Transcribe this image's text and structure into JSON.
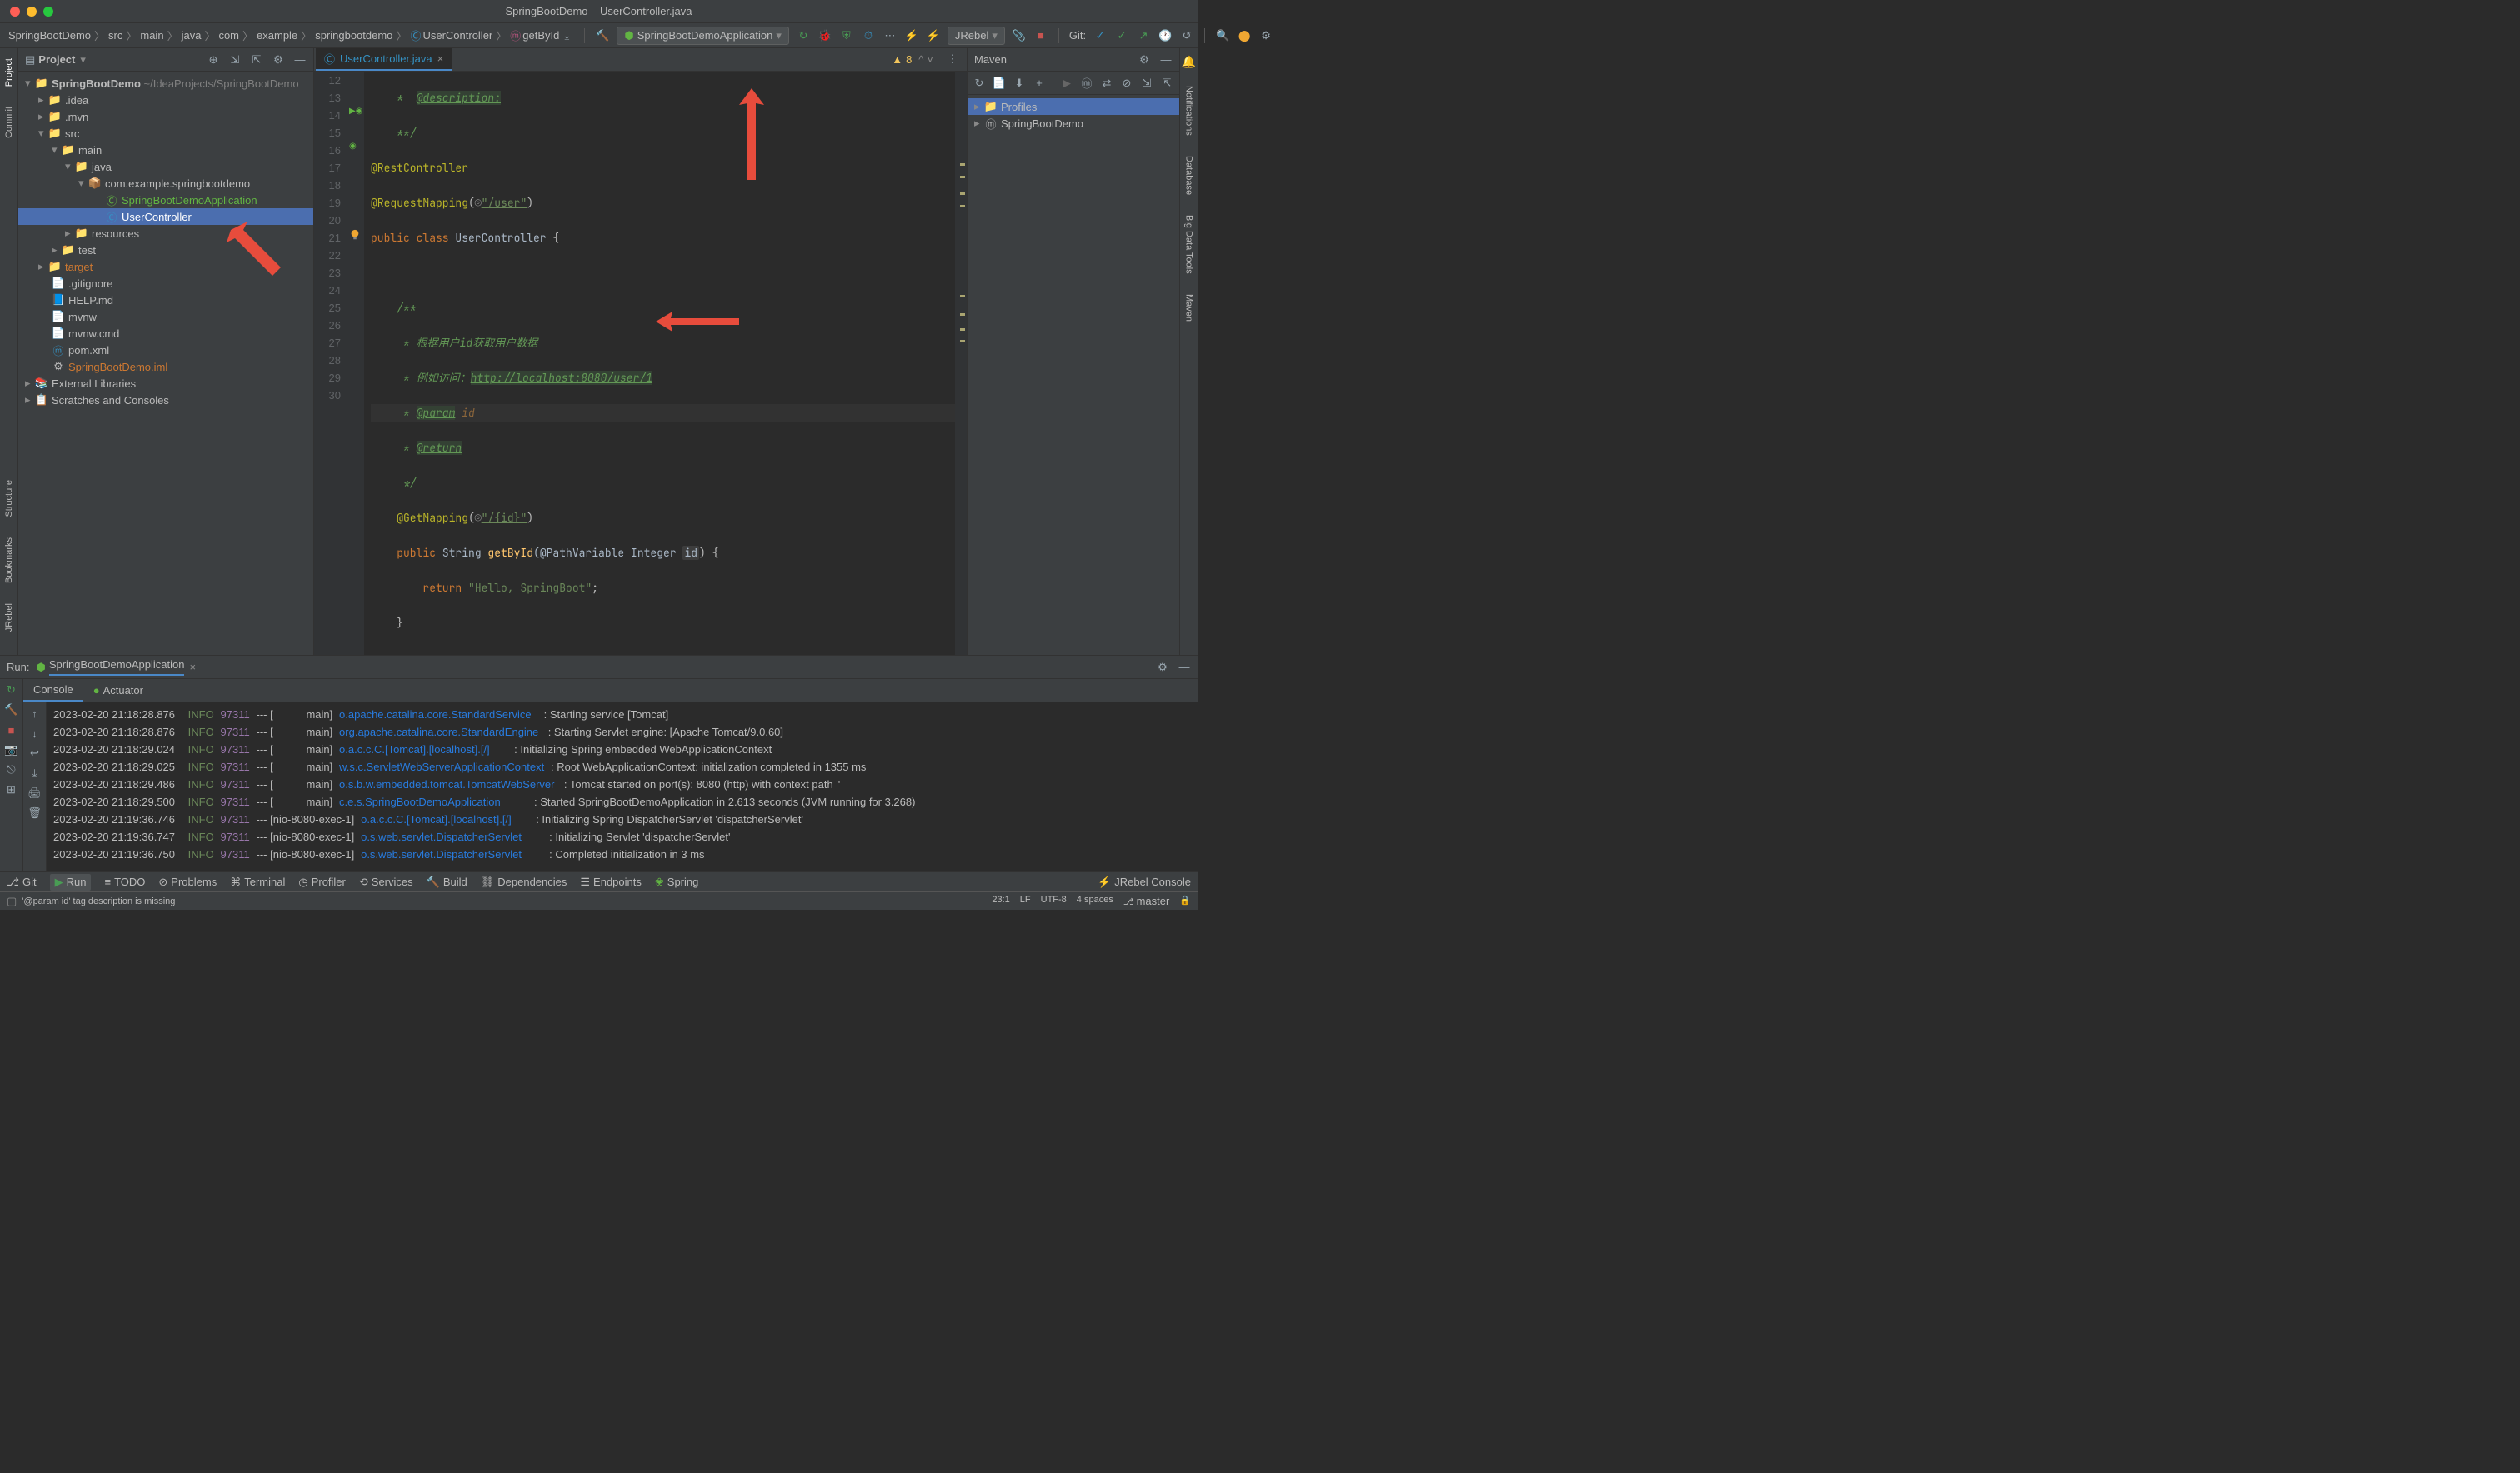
{
  "window": {
    "title": "SpringBootDemo – UserController.java"
  },
  "breadcrumbs": [
    "SpringBootDemo",
    "src",
    "main",
    "java",
    "com",
    "example",
    "springbootdemo",
    "UserController",
    "getById"
  ],
  "run_config": "SpringBootDemoApplication",
  "vcs_label": "Git:",
  "jrebel_label": "JRebel",
  "project_panel_title": "Project",
  "project_root": "SpringBootDemo",
  "project_root_path": "~/IdeaProjects/SpringBootDemo",
  "tree": {
    "idea": ".idea",
    "mvn": ".mvn",
    "src": "src",
    "main": "main",
    "java": "java",
    "pkg": "com.example.springbootdemo",
    "app": "SpringBootDemoApplication",
    "ctrl": "UserController",
    "resources": "resources",
    "test": "test",
    "target": "target",
    "gitignore": ".gitignore",
    "help": "HELP.md",
    "mvnw": "mvnw",
    "mvnwcmd": "mvnw.cmd",
    "pom": "pom.xml",
    "iml": "SpringBootDemo.iml",
    "extlib": "External Libraries",
    "scratch": "Scratches and Consoles"
  },
  "tab_file": "UserController.java",
  "editor": {
    "l12a": "    *  ",
    "l12b": "@description:",
    "l13": "    **/",
    "l14a": "@RestController",
    "l15a": "@RequestMapping",
    "l15b": "(",
    "l15c": "\"/user\"",
    "l15d": ")",
    "l16a": "public class ",
    "l16b": "UserController",
    "l16c": " {",
    "l18": "    /**",
    "l19": "     * 根据用户id获取用户数据",
    "l20a": "     * 例如访问：",
    "l20b": "http://localhost:8080/user/1",
    "l21": "     * ",
    "l21b": "@param",
    "l21c": " id",
    "l22": "     * ",
    "l22b": "@return",
    "l23": "     */",
    "l24a": "    @GetMapping",
    "l24b": "(",
    "l24c": "\"/{id}\"",
    "l24d": ")",
    "l25a": "    public ",
    "l25b": "String ",
    "l25c": "getById",
    "l25d": "(@PathVariable Integer ",
    "l25e": "id",
    "l25f": ") {",
    "l26a": "        return ",
    "l26b": "\"Hello, SpringBoot\"",
    "l26c": ";",
    "l27": "    }",
    "l29": "}"
  },
  "lines": [
    "12",
    "13",
    "14",
    "15",
    "16",
    "17",
    "18",
    "19",
    "20",
    "21",
    "22",
    "23",
    "24",
    "25",
    "26",
    "27",
    "28",
    "29",
    "30"
  ],
  "inspection_count": "8",
  "maven": {
    "title": "Maven",
    "profiles": "Profiles",
    "project": "SpringBootDemo"
  },
  "run": {
    "label": "Run:",
    "target": "SpringBootDemoApplication",
    "tabs": [
      "Console",
      "Actuator"
    ]
  },
  "console": [
    {
      "ts": "2023-02-20 21:18:28.876",
      "lvl": "INFO",
      "pid": "97311",
      "thr": "[           main]",
      "src": "o.apache.catalina.core.StandardService  ",
      "msg": ": Starting service [Tomcat]"
    },
    {
      "ts": "2023-02-20 21:18:28.876",
      "lvl": "INFO",
      "pid": "97311",
      "thr": "[           main]",
      "src": "org.apache.catalina.core.StandardEngine ",
      "msg": ": Starting Servlet engine: [Apache Tomcat/9.0.60]"
    },
    {
      "ts": "2023-02-20 21:18:29.024",
      "lvl": "INFO",
      "pid": "97311",
      "thr": "[           main]",
      "src": "o.a.c.c.C.[Tomcat].[localhost].[/]      ",
      "msg": ": Initializing Spring embedded WebApplicationContext"
    },
    {
      "ts": "2023-02-20 21:18:29.025",
      "lvl": "INFO",
      "pid": "97311",
      "thr": "[           main]",
      "src": "w.s.c.ServletWebServerApplicationContext",
      "msg": ": Root WebApplicationContext: initialization completed in 1355 ms"
    },
    {
      "ts": "2023-02-20 21:18:29.486",
      "lvl": "INFO",
      "pid": "97311",
      "thr": "[           main]",
      "src": "o.s.b.w.embedded.tomcat.TomcatWebServer ",
      "msg": ": Tomcat started on port(s): 8080 (http) with context path ''"
    },
    {
      "ts": "2023-02-20 21:18:29.500",
      "lvl": "INFO",
      "pid": "97311",
      "thr": "[           main]",
      "src": "c.e.s.SpringBootDemoApplication         ",
      "msg": ": Started SpringBootDemoApplication in 2.613 seconds (JVM running for 3.268)"
    },
    {
      "ts": "2023-02-20 21:19:36.746",
      "lvl": "INFO",
      "pid": "97311",
      "thr": "[nio-8080-exec-1]",
      "src": "o.a.c.c.C.[Tomcat].[localhost].[/]      ",
      "msg": ": Initializing Spring DispatcherServlet 'dispatcherServlet'"
    },
    {
      "ts": "2023-02-20 21:19:36.747",
      "lvl": "INFO",
      "pid": "97311",
      "thr": "[nio-8080-exec-1]",
      "src": "o.s.web.servlet.DispatcherServlet       ",
      "msg": ": Initializing Servlet 'dispatcherServlet'"
    },
    {
      "ts": "2023-02-20 21:19:36.750",
      "lvl": "INFO",
      "pid": "97311",
      "thr": "[nio-8080-exec-1]",
      "src": "o.s.web.servlet.DispatcherServlet       ",
      "msg": ": Completed initialization in 3 ms"
    }
  ],
  "bottom": {
    "git": "Git",
    "run": "Run",
    "todo": "TODO",
    "problems": "Problems",
    "terminal": "Terminal",
    "profiler": "Profiler",
    "services": "Services",
    "build": "Build",
    "deps": "Dependencies",
    "endpoints": "Endpoints",
    "spring": "Spring",
    "jrebel": "JRebel Console"
  },
  "status": {
    "msg": "'@param id' tag description is missing",
    "pos": "23:1",
    "lf": "LF",
    "enc": "UTF-8",
    "indent": "4 spaces",
    "branch": "master"
  },
  "sidetabs_l": [
    "Project",
    "Commit",
    "Structure",
    "Bookmarks",
    "JRebel"
  ],
  "sidetabs_r": [
    "Notifications",
    "Database",
    "Big Data Tools",
    "Maven"
  ]
}
